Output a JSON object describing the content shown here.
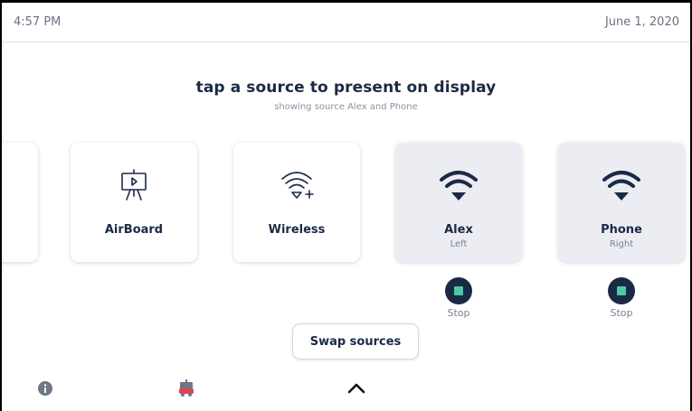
{
  "status_bar": {
    "time": "4:57 PM",
    "date": "June 1, 2020"
  },
  "header": {
    "title": "tap a source to present on display",
    "subtitle": "showing source Alex and Phone"
  },
  "sources": [
    {
      "label": "AirBoard",
      "sub": "",
      "icon": "airboard-icon",
      "active": false
    },
    {
      "label": "Wireless",
      "sub": "",
      "icon": "wireless-add-icon",
      "active": false
    },
    {
      "label": "Alex",
      "sub": "Left",
      "icon": "wifi-icon",
      "active": true
    },
    {
      "label": "Phone",
      "sub": "Right",
      "icon": "wifi-icon",
      "active": true
    }
  ],
  "stop_label": "Stop",
  "swap_button": "Swap sources",
  "bottom_bar": {
    "icons": [
      "info-icon",
      "cart-icon",
      "chevron-up-icon"
    ]
  },
  "colors": {
    "navy": "#1b2a44",
    "stop_accent": "#4cc9a8",
    "active_card": "#ecedf2",
    "cart_red": "#e0444a"
  }
}
